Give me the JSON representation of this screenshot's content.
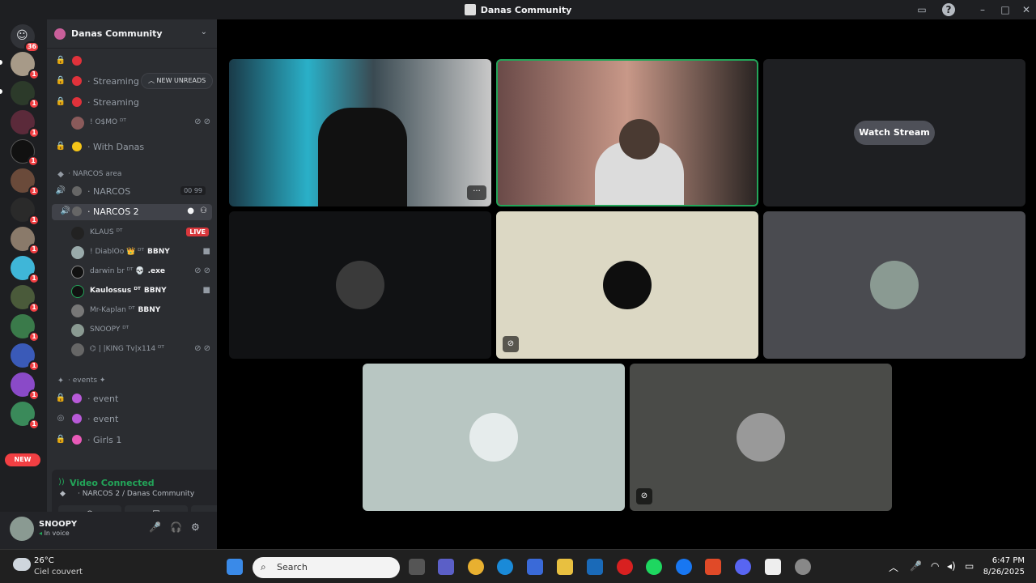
{
  "window": {
    "title": "Danas Community"
  },
  "rail": {
    "top_badge": "36",
    "new_label": "NEW",
    "badge_one": "1"
  },
  "server": {
    "name": "Danas Community"
  },
  "new_unreads": "NEW UNREADS",
  "channels": {
    "streaming1": "Streaming",
    "streaming2": "Streaming",
    "oesmo": "! O$MO",
    "with_danas": "With Danas",
    "narcos_area": "NARCOS area",
    "narcos": "NARCOS",
    "narcos_counts": "00 99",
    "narcos2": "NARCOS 2",
    "events_cat": "events",
    "event1": "event",
    "event2": "event",
    "girls1": "Girls 1"
  },
  "voice_users": [
    {
      "name": "KLAUS",
      "suffix": "ᴰᵀ",
      "tag": "",
      "extra": "LIVE"
    },
    {
      "name": "! DiablOo",
      "suffix": "ᴰᵀ",
      "tag": "BBNY",
      "extra": ""
    },
    {
      "name": "darwin br",
      "suffix": "ᴰᵀ",
      "tag": ".exe",
      "extra": ""
    },
    {
      "name": "Kaulossus",
      "suffix": "ᴰᵀ",
      "tag": "BBNY",
      "extra": ""
    },
    {
      "name": "Mr-Kaplan",
      "suffix": "ᴰᵀ",
      "tag": "BBNY",
      "extra": ""
    },
    {
      "name": "SNOOPY",
      "suffix": "ᴰᵀ",
      "tag": "",
      "extra": ""
    },
    {
      "name": "⌬ | |KING Tv|x114",
      "suffix": "ᴰᵀ",
      "tag": "",
      "extra": ""
    }
  ],
  "voice_panel": {
    "status": "Video Connected",
    "location": "NARCOS 2 / Danas Community"
  },
  "user_panel": {
    "name": "SNOOPY",
    "status": "In voice"
  },
  "stage": {
    "watch_stream": "Watch Stream"
  },
  "taskbar": {
    "temp": "26°C",
    "weather": "Ciel couvert",
    "search_placeholder": "Search",
    "time": "6:47 PM",
    "date": "8/26/2025"
  },
  "colors": {
    "accent_green": "#23a559",
    "live_red": "#da373c",
    "badge_red": "#f23f43"
  }
}
